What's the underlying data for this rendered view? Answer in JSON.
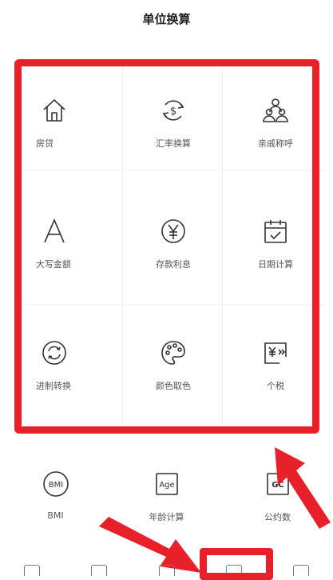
{
  "header": {
    "title": "单位换算"
  },
  "grid_items": [
    {
      "label": "房贷",
      "icon": "house-icon"
    },
    {
      "label": "汇率换算",
      "icon": "currency-exchange-icon"
    },
    {
      "label": "亲戚称呼",
      "icon": "family-icon"
    },
    {
      "label": "大写金额",
      "icon": "letter-a-icon"
    },
    {
      "label": "存款利息",
      "icon": "yen-coin-icon"
    },
    {
      "label": "日期计算",
      "icon": "calendar-check-icon"
    },
    {
      "label": "进制转换",
      "icon": "refresh-icon"
    },
    {
      "label": "颜色取色",
      "icon": "palette-icon"
    },
    {
      "label": "个税",
      "icon": "tax-icon"
    }
  ],
  "row2_items": [
    {
      "label": "BMI",
      "icon_text": "BMI",
      "icon": "bmi-icon"
    },
    {
      "label": "年龄计算",
      "icon_text": "Age",
      "icon": "age-icon"
    },
    {
      "label": "公约数",
      "icon_text": "GC",
      "icon": "gcd-icon"
    }
  ],
  "colors": {
    "highlight": "#e8202a",
    "active_tab": "#4a90e2"
  }
}
